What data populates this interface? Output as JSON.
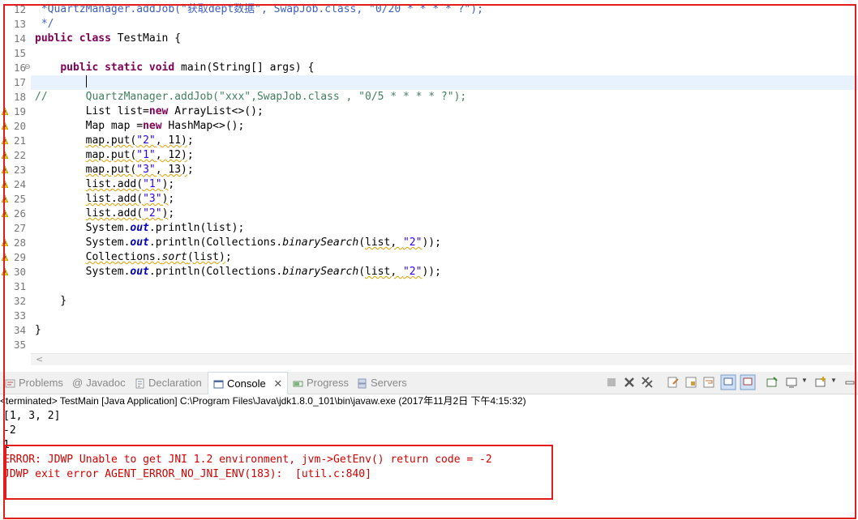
{
  "editor": {
    "lines": [
      {
        "n": "12",
        "html": "<span class=\"jd\"> *QuartzManager.addJob(\"<span class=\\\"sq\\\">获取dept数据</span>\", SwapJob.class, \"0/20 * * * * ?\");</span>"
      },
      {
        "n": "13",
        "html": "<span class=\"jd\"> */</span>"
      },
      {
        "n": "14",
        "html": "<span class=\"kw\">public class</span> TestMain {"
      },
      {
        "n": "15",
        "html": ""
      },
      {
        "n": "16",
        "html": "    <span class=\"kw\">public static void</span> main(String[] args) {"
      },
      {
        "n": "17",
        "html": ""
      },
      {
        "n": "18",
        "html": "<span class=\"cm\">//      QuartzManager.addJob(\"<span class=\\\"sq\\\">xxx</span>\",SwapJob.class , \"0/5 * * * * ?\");</span>"
      },
      {
        "n": "19",
        "html": "        List list=<span class=\"kw\">new</span> ArrayList&lt;&gt;();"
      },
      {
        "n": "20",
        "html": "        Map map =<span class=\"kw\">new</span> HashMap&lt;&gt;();"
      },
      {
        "n": "21",
        "html": "        <span class=\"sq\">map.put(<span class=\"str\">\"2\"</span>, 11)</span>;"
      },
      {
        "n": "22",
        "html": "        <span class=\"sq\">map.put(<span class=\"str\">\"1\"</span>, 12)</span>;"
      },
      {
        "n": "23",
        "html": "        <span class=\"sq\">map.put(<span class=\"str\">\"3\"</span>, 13)</span>;"
      },
      {
        "n": "24",
        "html": "        <span class=\"sq\">list.add(<span class=\"str\">\"1\"</span>)</span>;"
      },
      {
        "n": "25",
        "html": "        <span class=\"sq\">list.add(<span class=\"str\">\"3\"</span>)</span>;"
      },
      {
        "n": "26",
        "html": "        <span class=\"sq\">list.add(<span class=\"str\">\"2\"</span>)</span>;"
      },
      {
        "n": "27",
        "html": "        System.<span class=\"fld\">out</span>.println(list);"
      },
      {
        "n": "28",
        "html": "        System.<span class=\"fld\">out</span>.println(Collections.<span class=\"it\">binarySearch</span>(<span class=\"sq\">list, <span class=\"str\">\"2\"</span></span>));"
      },
      {
        "n": "29",
        "html": "        <span class=\"sq\">Collections.<span class=\"it\">sort</span>(list)</span>;"
      },
      {
        "n": "30",
        "html": "        System.<span class=\"fld\">out</span>.println(Collections.<span class=\"it\">binarySearch</span>(<span class=\"sq\">list, <span class=\"str\">\"2\"</span></span>));"
      },
      {
        "n": "31",
        "html": ""
      },
      {
        "n": "32",
        "html": "    }"
      },
      {
        "n": "33",
        "html": ""
      },
      {
        "n": "34",
        "html": "}"
      },
      {
        "n": "35",
        "html": ""
      }
    ],
    "warning_lines": [
      "19",
      "20",
      "21",
      "22",
      "23",
      "24",
      "25",
      "26",
      "28",
      "29",
      "30"
    ],
    "current_line": "17"
  },
  "tabs": [
    {
      "label": "Problems",
      "icon": "problems-icon"
    },
    {
      "label": "Javadoc",
      "icon": "at-icon"
    },
    {
      "label": "Declaration",
      "icon": "declaration-icon"
    },
    {
      "label": "Console",
      "icon": "console-icon",
      "active": true
    },
    {
      "label": "Progress",
      "icon": "progress-icon"
    },
    {
      "label": "Servers",
      "icon": "servers-icon"
    }
  ],
  "console": {
    "status": "<terminated> TestMain [Java Application] C:\\Program Files\\Java\\jdk1.8.0_101\\bin\\javaw.exe (2017年11月2日 下午4:15:32)",
    "output": [
      "[1, 3, 2]",
      "-2",
      "1"
    ],
    "errors": [
      "ERROR: JDWP Unable to get JNI 1.2 environment, jvm->GetEnv() return code = -2",
      "JDWP exit error AGENT_ERROR_NO_JNI_ENV(183):  [util.c:840]"
    ]
  },
  "colors": {
    "keyword": "#7f0055",
    "string": "#2a00ff",
    "comment": "#3f7f5f",
    "error_text": "#d00000",
    "highlight_box": "#e31c1c"
  }
}
